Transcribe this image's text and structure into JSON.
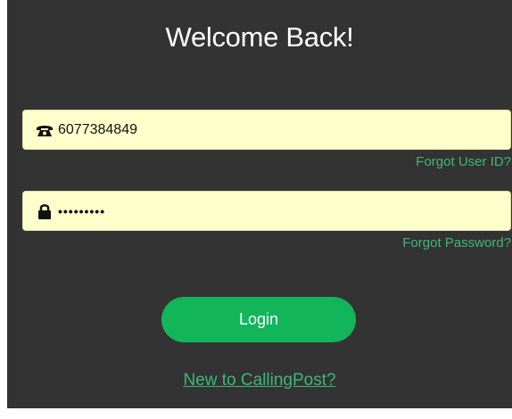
{
  "header": {
    "title": "Welcome Back!"
  },
  "form": {
    "user_id": {
      "value": "6077384849",
      "icon": "phone-icon"
    },
    "password": {
      "value": "•••••••••",
      "icon": "lock-icon"
    },
    "forgot_user_id_label": "Forgot User ID?",
    "forgot_password_label": "Forgot Password?",
    "login_label": "Login",
    "signup_label": "New to CallingPost?"
  },
  "colors": {
    "background": "#333333",
    "field_background": "#ffffcc",
    "accent": "#12b55a",
    "link": "#3cb878"
  }
}
